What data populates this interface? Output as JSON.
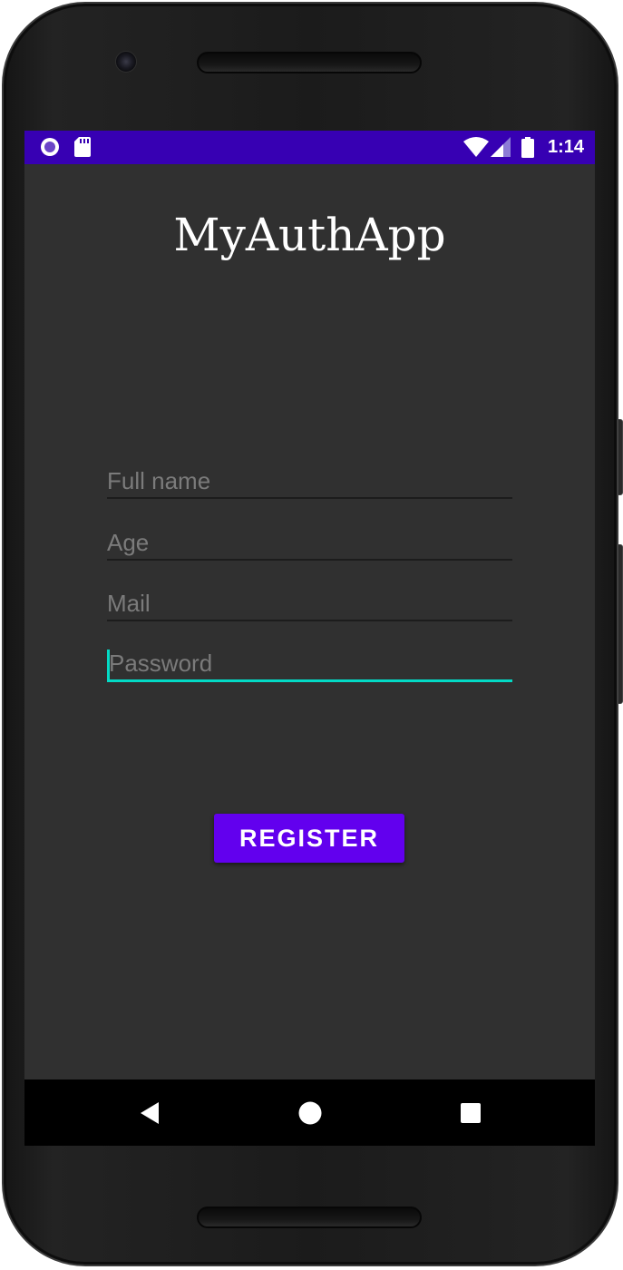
{
  "status_bar": {
    "time": "1:14",
    "left_icons": [
      "notification-dot-icon",
      "sd-card-icon"
    ],
    "right_icons": [
      "wifi-icon",
      "cellular-signal-icon",
      "battery-icon"
    ],
    "color": "#3700b3"
  },
  "app": {
    "title": "MyAuthApp"
  },
  "form": {
    "full_name_placeholder": "Full name",
    "age_placeholder": "Age",
    "mail_placeholder": "Mail",
    "password_placeholder": "Password",
    "focused_field": "password",
    "accent_color": "#03dac5"
  },
  "register_button": {
    "label": "REGISTER",
    "color": "#6200ee"
  },
  "nav_bar": {
    "icons": [
      "back-icon",
      "home-icon",
      "recents-icon"
    ]
  }
}
